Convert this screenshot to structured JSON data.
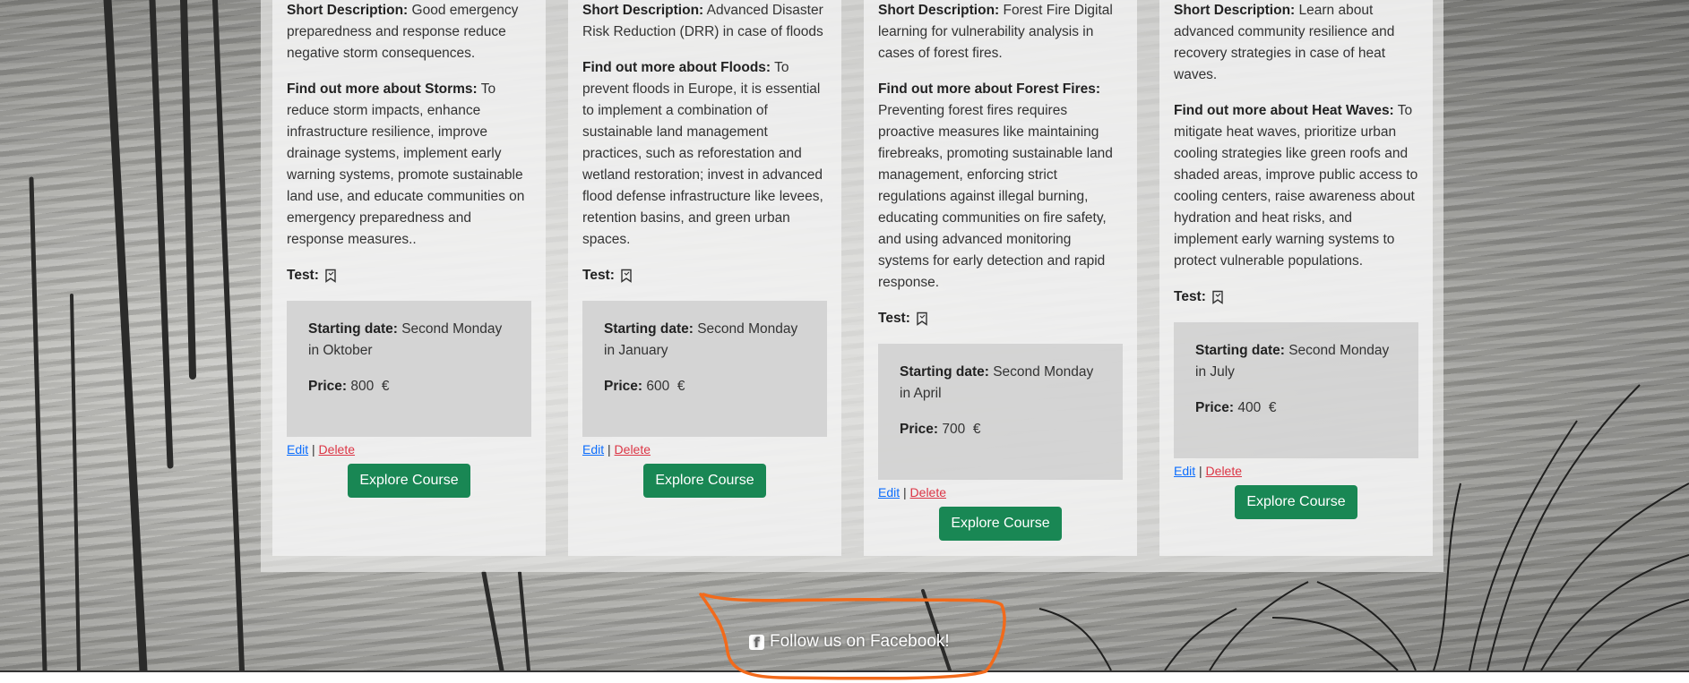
{
  "courses": [
    {
      "short_desc_label": "Short Description:",
      "short_desc": "Good emergency preparedness and response reduce negative storm consequences.",
      "more_label": "Find out more about Storms:",
      "more_text": "To reduce storm impacts, enhance infrastructure resilience, improve drainage systems, implement early warning systems, promote sustainable land use, and educate communities on emergency preparedness and response measures..",
      "test_label": "Test:",
      "start_label": "Starting date:",
      "start_value": "Second Monday in Oktober",
      "price_label": "Price:",
      "price_value": "800",
      "currency": "€",
      "edit_label": "Edit",
      "separator": "|",
      "delete_label": "Delete",
      "explore_label": "Explore Course"
    },
    {
      "short_desc_label": "Short Description:",
      "short_desc": "Advanced Disaster Risk Reduction (DRR) in case of floods",
      "more_label": "Find out more about Floods:",
      "more_text": "To prevent floods in Europe, it is essential to implement a combination of sustainable land management practices, such as reforestation and wetland restoration; invest in advanced flood defense infrastructure like levees, retention basins, and green urban spaces.",
      "test_label": "Test:",
      "start_label": "Starting date:",
      "start_value": "Second Monday in January",
      "price_label": "Price:",
      "price_value": "600",
      "currency": "€",
      "edit_label": "Edit",
      "separator": "|",
      "delete_label": "Delete",
      "explore_label": "Explore Course"
    },
    {
      "short_desc_label": "Short Description:",
      "short_desc": "Forest Fire Digital learning for vulnerability analysis in cases of forest fires.",
      "more_label": "Find out more about Forest Fires:",
      "more_text": "Preventing forest fires requires proactive measures like maintaining firebreaks, promoting sustainable land management, enforcing strict regulations against illegal burning, educating communities on fire safety, and using advanced monitoring systems for early detection and rapid response.",
      "test_label": "Test:",
      "start_label": "Starting date:",
      "start_value": "Second Monday in April",
      "price_label": "Price:",
      "price_value": "700",
      "currency": "€",
      "edit_label": "Edit",
      "separator": "|",
      "delete_label": "Delete",
      "explore_label": "Explore Course"
    },
    {
      "short_desc_label": "Short Description:",
      "short_desc": "Learn about advanced community resilience and recovery strategies in case of heat waves.",
      "more_label": "Find out more about Heat Waves:",
      "more_text": "To mitigate heat waves, prioritize urban cooling strategies like green roofs and shaded areas, improve public access to cooling centers, raise awareness about hydration and heat risks, and implement early warning systems to protect vulnerable populations.",
      "test_label": "Test:",
      "start_label": "Starting date:",
      "start_value": "Second Monday in July",
      "price_label": "Price:",
      "price_value": "400",
      "currency": "€",
      "edit_label": "Edit",
      "separator": "|",
      "delete_label": "Delete",
      "explore_label": "Explore Course"
    }
  ],
  "footer": {
    "facebook_label": "Follow us on Facebook!",
    "facebook_icon": "facebook-square-icon"
  },
  "colors": {
    "button": "#198754",
    "edit_link": "#0d6efd",
    "delete_link": "#dc3545",
    "annotation": "#f26a1b"
  }
}
